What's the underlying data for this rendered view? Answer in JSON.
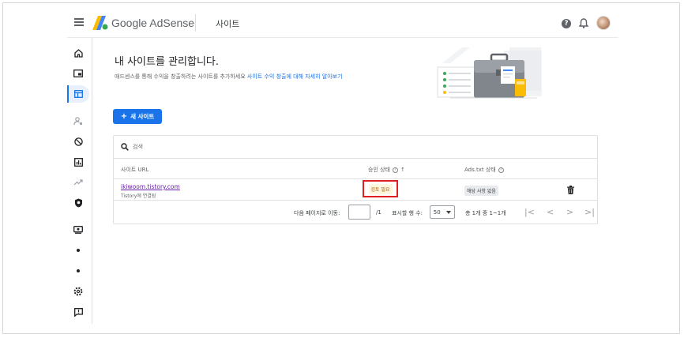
{
  "header": {
    "brand": "Google AdSense",
    "page_name": "사이트",
    "help_glyph": "?"
  },
  "main": {
    "title": "내 사이트를 관리합니다.",
    "desc_prefix": "애드센스를 통해 수익을 창출하려는 사이트를 추가하세요 ",
    "desc_link": "사이트 수익 창출에 대해 자세히 알아보기",
    "new_site_button": "새 사이트",
    "plus_glyph": "+"
  },
  "table": {
    "search_placeholder": "검색",
    "columns": {
      "url": "사이트 URL",
      "status": "승인 상태",
      "ads_txt": "Ads.txt 상태",
      "sort_glyph": "↑",
      "q_glyph": "?"
    },
    "rows": [
      {
        "url": "ikiwoom.tistory.com",
        "sub": "Tistory에 연결됨",
        "status": "검토 필요",
        "ads_txt": "해당 사항 없음"
      }
    ]
  },
  "pager": {
    "go_to_page_label": "다음 페이지로 이동:",
    "page_input_value": "",
    "page_total": "/1",
    "rows_per_page_label": "표시할 행 수:",
    "rows_per_page_value": "50",
    "range_text": "총 1개 중 1~1개",
    "first_glyph": "|<",
    "prev_glyph": "<",
    "next_glyph": ">",
    "last_glyph": ">|"
  },
  "colors": {
    "primary": "#1a73e8",
    "status_warning_bg": "#fef7e0",
    "highlight_border": "#e02020",
    "visited_link": "#681da8"
  }
}
